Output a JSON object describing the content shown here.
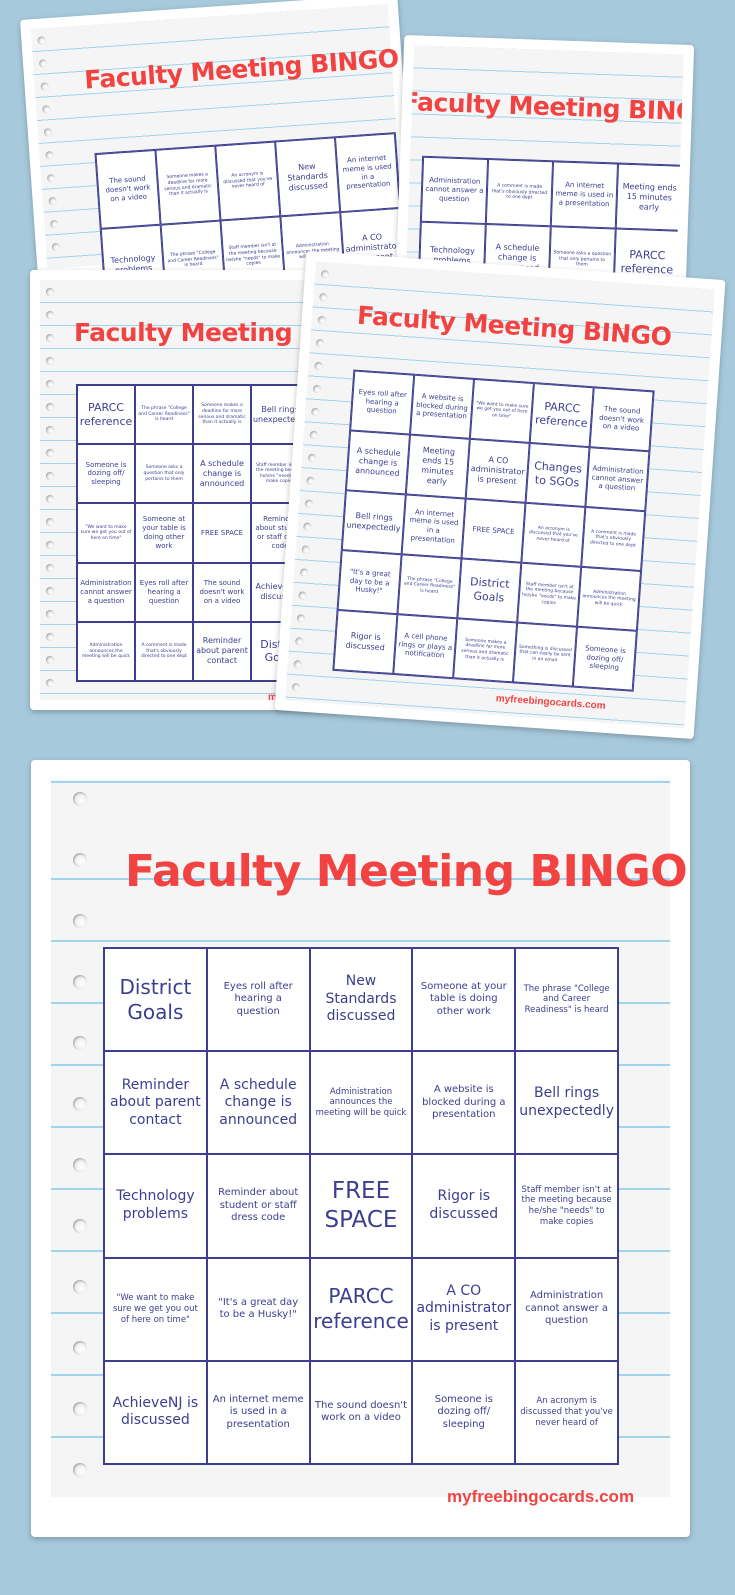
{
  "title": "Faculty Meeting BINGO",
  "brand": "myfreebingocards.com",
  "colors": {
    "background": "#a6c9dc",
    "title": "#f24343",
    "grid": "#3d3e8f",
    "paper": "#f5f5f5",
    "rule_line": "#9fd3ee"
  },
  "main_card": {
    "cells": [
      "District Goals",
      "Eyes roll after hearing a question",
      "New Standards discussed",
      "Someone at your table is doing other work",
      "The phrase \"College and Career Readiness\" is heard",
      "Reminder about parent contact",
      "A schedule change is announced",
      "Administration announces the meeting will be quick",
      "A website is blocked during a presentation",
      "Bell rings unexpectedly",
      "Technology problems",
      "Reminder about student or staff dress code",
      "FREE SPACE",
      "Rigor is discussed",
      "Staff member isn't at the meeting because he/she \"needs\" to make copies",
      "\"We want to make sure we get you out of here on time\"",
      "\"It's a great day to be a Husky!\"",
      "PARCC reference",
      "A CO administrator is present",
      "Administration cannot answer a question",
      "AchieveNJ is discussed",
      "An internet meme is used in a presentation",
      "The sound doesn't work on a video",
      "Someone is dozing off/ sleeping",
      "An acronym is discussed that you've never heard of"
    ]
  },
  "collage": {
    "card1": {
      "cells": [
        "The sound doesn't work on a video",
        "Someone makes a deadline far more serious and dramatic than it actually is",
        "An acronym is discussed that you've never heard of",
        "New Standards discussed",
        "An internet meme is used in a presentation",
        "Technology problems",
        "The phrase \"College and Career Readiness\" is heard",
        "Staff member isn't at the meeting because he/she \"needs\" to make copies",
        "Administration announces the meeting will be quick",
        "A CO administrator is present"
      ]
    },
    "card2": {
      "cells": [
        "Administration cannot answer a question",
        "A comment is made that's obviously directed to one dept",
        "An internet meme is used in a presentation",
        "Meeting ends 15 minutes early",
        "Technology problems",
        "A schedule change is announced",
        "Someone asks a question that only pertains to them",
        "PARCC reference"
      ]
    },
    "card3": {
      "cells": [
        "PARCC reference",
        "The phrase \"College and Career Readiness\" is heard",
        "Someone makes a deadline far more serious and dramatic than it actually is",
        "Bell rings unexpectedly",
        "New Standards discussed",
        "Someone is dozing off/ sleeping",
        "Someone asks a question that only pertains to them",
        "A schedule change is announced",
        "Staff member isn't at the meeting because he/she \"needs\" to make copies",
        "Meeting ends 15 minutes early",
        "\"We want to make sure we get you out of here on time\"",
        "Someone at your table is doing other work",
        "FREE SPACE",
        "Reminder about student or staff dress code",
        "Rigor is discussed",
        "Administration cannot answer a question",
        "Eyes roll after hearing a question",
        "The sound doesn't work on a video",
        "AchieveNJ is discussed",
        "Technology problems",
        "Administration announces the meeting will be quick",
        "A comment is made that's obviously directed to one dept",
        "Reminder about parent contact",
        "District Goals",
        "Changes to SGOs"
      ]
    },
    "card4": {
      "cells": [
        "Eyes roll after hearing a question",
        "A website is blocked during a presentation",
        "\"We want to make sure we get you out of here on time\"",
        "PARCC reference",
        "The sound doesn't work on a video",
        "A schedule change is announced",
        "Meeting ends 15 minutes early",
        "A CO administrator is present",
        "Changes to SGOs",
        "Administration cannot answer a question",
        "Bell rings unexpectedly",
        "An internet meme is used in a presentation",
        "FREE SPACE",
        "An acronym is discussed that you've never heard of",
        "A comment is made that's obviously directed to one dept",
        "\"It's a great day to be a Husky!\"",
        "The phrase \"College and Career Readiness\" is heard",
        "District Goals",
        "Staff member isn't at the meeting because he/she \"needs\" to make copies",
        "Administration announces the meeting will be quick",
        "Rigor is discussed",
        "A cell phone rings or plays a notification",
        "Someone makes a deadline far more serious and dramatic than it actually is",
        "Something is discussed that can easily be sent in an email",
        "Someone is dozing off/ sleeping"
      ]
    }
  }
}
